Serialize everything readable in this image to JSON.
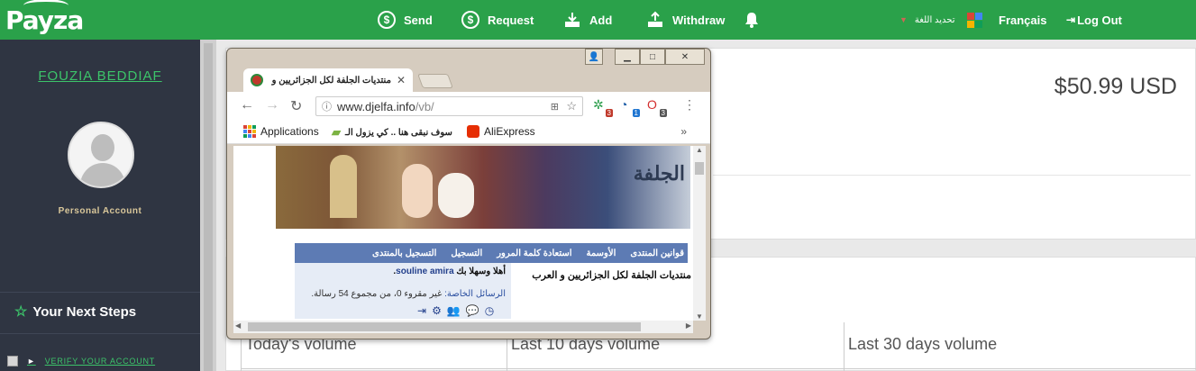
{
  "topbar": {
    "logo": "Payza",
    "nav": [
      {
        "label": "Send",
        "icon": "dollar-coin-icon"
      },
      {
        "label": "Request",
        "icon": "dollar-coin-icon"
      },
      {
        "label": "Add",
        "icon": "download-tray-icon"
      },
      {
        "label": "Withdraw",
        "icon": "upload-tray-icon"
      }
    ],
    "language_select": "تحديد اللغة",
    "language_link": "Français",
    "logout": "Log Out",
    "accent": "#2aa14a"
  },
  "sidebar": {
    "user_name": "FOUZIA BEDDIAF",
    "account_type": "Personal Account",
    "next_steps": "Your Next Steps",
    "verify": "VERIFY YOUR ACCOUNT"
  },
  "main": {
    "balance": "$50.99 USD",
    "volumes": [
      "Today's volume",
      "Last 10 days volume",
      "Last 30 days volume"
    ]
  },
  "browser": {
    "tab_title": "منتديات الجلفة لكل الجزائريين و",
    "url_host": "www.djelfa.info",
    "url_path": "/vb/",
    "bookmarks": [
      "Applications",
      "سوف نبقى هنا .. كي يزول الـ",
      "AliExpress"
    ],
    "ext_badges": [
      "3",
      "1",
      "3"
    ],
    "page": {
      "nav_links": [
        "قوانين المنتدى",
        "الأوسمة",
        "استعادة كلمة المرور",
        "التسجيل",
        "التسجيل بالمنتدى"
      ],
      "forum_title": "منتديات الجلفة لكل الجزائريين و العرب",
      "welcome_prefix": "أهلا وسهلا بك",
      "welcome_user": "souline amira",
      "pm_label": "الرسائل الخاصة:",
      "pm_text": "غير مقروء 0، من مجموع 54 رسالة."
    }
  }
}
